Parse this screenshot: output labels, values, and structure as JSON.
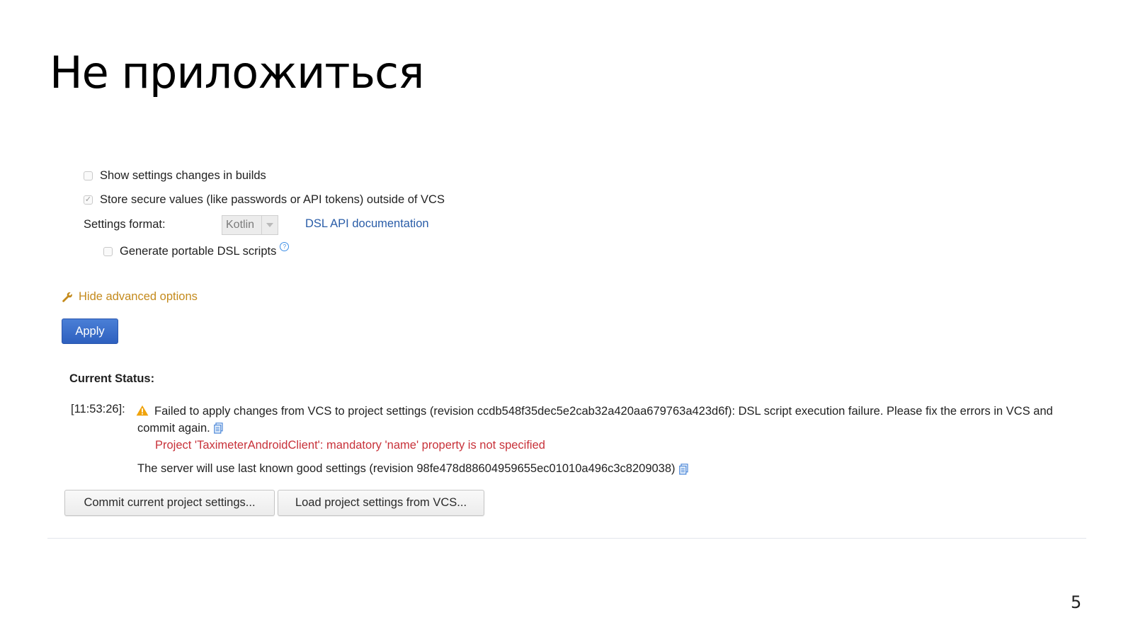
{
  "slide": {
    "title": "Не приложиться",
    "page_number": "5"
  },
  "settings": {
    "show_changes": {
      "label": "Show settings changes in builds",
      "checked": false
    },
    "store_secure": {
      "label": "Store secure values (like passwords or API tokens) outside of VCS",
      "checked": true,
      "check_glyph": "✓"
    },
    "format_label": "Settings format:",
    "format_select": {
      "value": "Kotlin"
    },
    "dsl_doc_link": "DSL API documentation",
    "portable_dsl": {
      "label": "Generate portable DSL scripts",
      "checked": false,
      "help_glyph": "?"
    },
    "advanced_toggle": "Hide advanced options",
    "apply_label": "Apply"
  },
  "status": {
    "heading": "Current Status:",
    "timestamp": "[11:53:26]:",
    "warning_message": "Failed to apply changes from VCS to project settings (revision ccdb548f35dec5e2cab32a420aa679763a423d6f): DSL script execution failure. Please fix the errors in VCS and commit again.",
    "error_detail": "Project 'TaximeterAndroidClient': mandatory 'name' property is not specified",
    "fallback_message": "The server will use last known good settings (revision 98fe478d88604959655ec01010a496c3c8209038)",
    "colors": {
      "warning": "#f0a30a",
      "error": "#c8323a",
      "link": "#2a5da8",
      "advanced": "#c48a1c",
      "primary_button": "#3a6ccb"
    }
  },
  "actions": {
    "commit_label": "Commit current project settings...",
    "load_label": "Load project settings from VCS..."
  }
}
